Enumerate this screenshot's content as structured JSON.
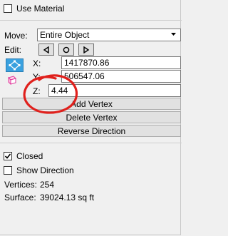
{
  "use_material": {
    "label": "Use Material",
    "checked": false
  },
  "move": {
    "label": "Move:",
    "value": "Entire Object"
  },
  "edit": {
    "label": "Edit:",
    "buttons": [
      "left-arrow",
      "circle",
      "right-arrow"
    ]
  },
  "coords": {
    "x": {
      "label": "X:",
      "value": "1417870.86"
    },
    "y": {
      "label": "Y:",
      "value": "506547.06"
    },
    "z": {
      "label": "Z:",
      "value": "4.44"
    }
  },
  "buttons": {
    "add_vertex": "Add Vertex",
    "delete_vertex": "Delete Vertex",
    "reverse_direction": "Reverse Direction"
  },
  "closed": {
    "label": "Closed",
    "checked": true
  },
  "show_direction": {
    "label": "Show Direction",
    "checked": false
  },
  "stats": {
    "vertices_label": "Vertices:",
    "vertices_value": "254",
    "surface_label": "Surface:",
    "surface_value": "39024.13 sq ft"
  },
  "annotation_color": "#e0201c"
}
